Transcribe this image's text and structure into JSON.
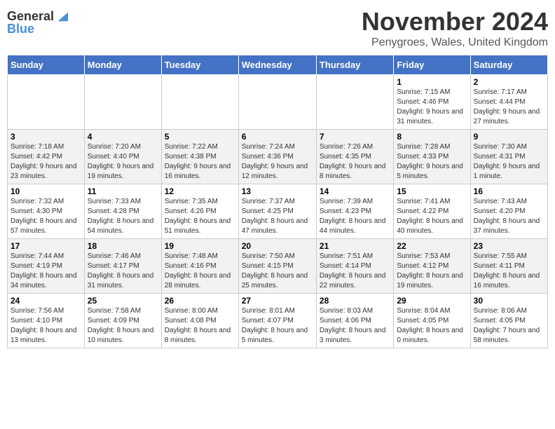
{
  "logo": {
    "general": "General",
    "blue": "Blue"
  },
  "title": "November 2024",
  "location": "Penygroes, Wales, United Kingdom",
  "days_of_week": [
    "Sunday",
    "Monday",
    "Tuesday",
    "Wednesday",
    "Thursday",
    "Friday",
    "Saturday"
  ],
  "weeks": [
    [
      {
        "day": "",
        "info": ""
      },
      {
        "day": "",
        "info": ""
      },
      {
        "day": "",
        "info": ""
      },
      {
        "day": "",
        "info": ""
      },
      {
        "day": "",
        "info": ""
      },
      {
        "day": "1",
        "info": "Sunrise: 7:15 AM\nSunset: 4:46 PM\nDaylight: 9 hours and 31 minutes."
      },
      {
        "day": "2",
        "info": "Sunrise: 7:17 AM\nSunset: 4:44 PM\nDaylight: 9 hours and 27 minutes."
      }
    ],
    [
      {
        "day": "3",
        "info": "Sunrise: 7:18 AM\nSunset: 4:42 PM\nDaylight: 9 hours and 23 minutes."
      },
      {
        "day": "4",
        "info": "Sunrise: 7:20 AM\nSunset: 4:40 PM\nDaylight: 9 hours and 19 minutes."
      },
      {
        "day": "5",
        "info": "Sunrise: 7:22 AM\nSunset: 4:38 PM\nDaylight: 9 hours and 16 minutes."
      },
      {
        "day": "6",
        "info": "Sunrise: 7:24 AM\nSunset: 4:36 PM\nDaylight: 9 hours and 12 minutes."
      },
      {
        "day": "7",
        "info": "Sunrise: 7:26 AM\nSunset: 4:35 PM\nDaylight: 9 hours and 8 minutes."
      },
      {
        "day": "8",
        "info": "Sunrise: 7:28 AM\nSunset: 4:33 PM\nDaylight: 9 hours and 5 minutes."
      },
      {
        "day": "9",
        "info": "Sunrise: 7:30 AM\nSunset: 4:31 PM\nDaylight: 9 hours and 1 minute."
      }
    ],
    [
      {
        "day": "10",
        "info": "Sunrise: 7:32 AM\nSunset: 4:30 PM\nDaylight: 8 hours and 57 minutes."
      },
      {
        "day": "11",
        "info": "Sunrise: 7:33 AM\nSunset: 4:28 PM\nDaylight: 8 hours and 54 minutes."
      },
      {
        "day": "12",
        "info": "Sunrise: 7:35 AM\nSunset: 4:26 PM\nDaylight: 8 hours and 51 minutes."
      },
      {
        "day": "13",
        "info": "Sunrise: 7:37 AM\nSunset: 4:25 PM\nDaylight: 8 hours and 47 minutes."
      },
      {
        "day": "14",
        "info": "Sunrise: 7:39 AM\nSunset: 4:23 PM\nDaylight: 8 hours and 44 minutes."
      },
      {
        "day": "15",
        "info": "Sunrise: 7:41 AM\nSunset: 4:22 PM\nDaylight: 8 hours and 40 minutes."
      },
      {
        "day": "16",
        "info": "Sunrise: 7:43 AM\nSunset: 4:20 PM\nDaylight: 8 hours and 37 minutes."
      }
    ],
    [
      {
        "day": "17",
        "info": "Sunrise: 7:44 AM\nSunset: 4:19 PM\nDaylight: 8 hours and 34 minutes."
      },
      {
        "day": "18",
        "info": "Sunrise: 7:46 AM\nSunset: 4:17 PM\nDaylight: 8 hours and 31 minutes."
      },
      {
        "day": "19",
        "info": "Sunrise: 7:48 AM\nSunset: 4:16 PM\nDaylight: 8 hours and 28 minutes."
      },
      {
        "day": "20",
        "info": "Sunrise: 7:50 AM\nSunset: 4:15 PM\nDaylight: 8 hours and 25 minutes."
      },
      {
        "day": "21",
        "info": "Sunrise: 7:51 AM\nSunset: 4:14 PM\nDaylight: 8 hours and 22 minutes."
      },
      {
        "day": "22",
        "info": "Sunrise: 7:53 AM\nSunset: 4:12 PM\nDaylight: 8 hours and 19 minutes."
      },
      {
        "day": "23",
        "info": "Sunrise: 7:55 AM\nSunset: 4:11 PM\nDaylight: 8 hours and 16 minutes."
      }
    ],
    [
      {
        "day": "24",
        "info": "Sunrise: 7:56 AM\nSunset: 4:10 PM\nDaylight: 8 hours and 13 minutes."
      },
      {
        "day": "25",
        "info": "Sunrise: 7:58 AM\nSunset: 4:09 PM\nDaylight: 8 hours and 10 minutes."
      },
      {
        "day": "26",
        "info": "Sunrise: 8:00 AM\nSunset: 4:08 PM\nDaylight: 8 hours and 8 minutes."
      },
      {
        "day": "27",
        "info": "Sunrise: 8:01 AM\nSunset: 4:07 PM\nDaylight: 8 hours and 5 minutes."
      },
      {
        "day": "28",
        "info": "Sunrise: 8:03 AM\nSunset: 4:06 PM\nDaylight: 8 hours and 3 minutes."
      },
      {
        "day": "29",
        "info": "Sunrise: 8:04 AM\nSunset: 4:05 PM\nDaylight: 8 hours and 0 minutes."
      },
      {
        "day": "30",
        "info": "Sunrise: 8:06 AM\nSunset: 4:05 PM\nDaylight: 7 hours and 58 minutes."
      }
    ]
  ]
}
